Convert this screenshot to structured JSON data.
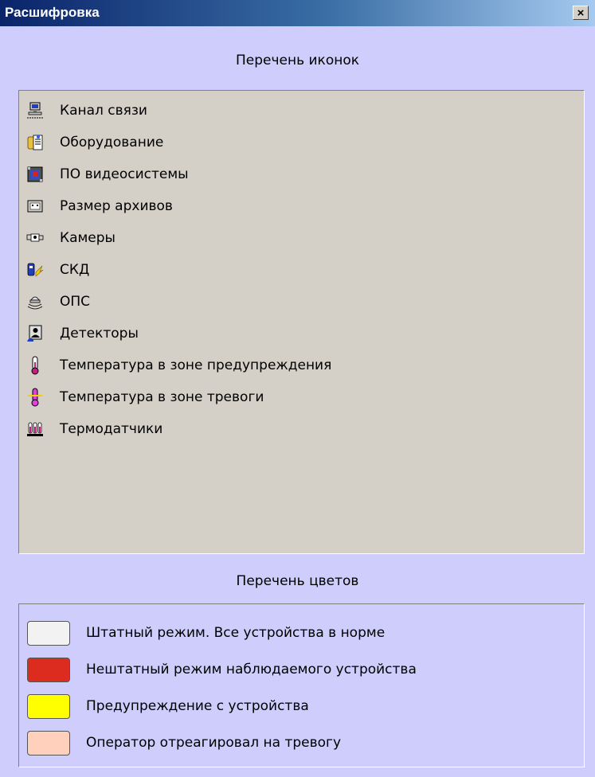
{
  "window": {
    "title": "Расшифровка",
    "close_label": "×"
  },
  "icons_section": {
    "heading": "Перечень иконок",
    "items": [
      {
        "icon": "network-channel-icon",
        "label": "Канал связи"
      },
      {
        "icon": "equipment-icon",
        "label": "Оборудование"
      },
      {
        "icon": "video-software-icon",
        "label": "ПО видеосистемы"
      },
      {
        "icon": "archive-size-icon",
        "label": "Размер архивов"
      },
      {
        "icon": "camera-icon",
        "label": "Камеры"
      },
      {
        "icon": "access-control-icon",
        "label": "СКД"
      },
      {
        "icon": "fire-alarm-icon",
        "label": "ОПС"
      },
      {
        "icon": "detector-icon",
        "label": "Детекторы"
      },
      {
        "icon": "thermometer-warning-icon",
        "label": "Температура в зоне предупреждения"
      },
      {
        "icon": "thermometer-alarm-icon",
        "label": "Температура в зоне тревоги"
      },
      {
        "icon": "thermosensors-icon",
        "label": "Термодатчики"
      }
    ]
  },
  "colors_section": {
    "heading": "Перечень цветов",
    "items": [
      {
        "color": "#f2f2f2",
        "label": "Штатный режим. Все устройства в норме"
      },
      {
        "color": "#dc2c1f",
        "label": "Нештатный режим наблюдаемого устройства"
      },
      {
        "color": "#ffff00",
        "label": "Предупреждение с устройства"
      },
      {
        "color": "#ffd0bc",
        "label": "Оператор отреагировал на тревогу"
      }
    ]
  }
}
